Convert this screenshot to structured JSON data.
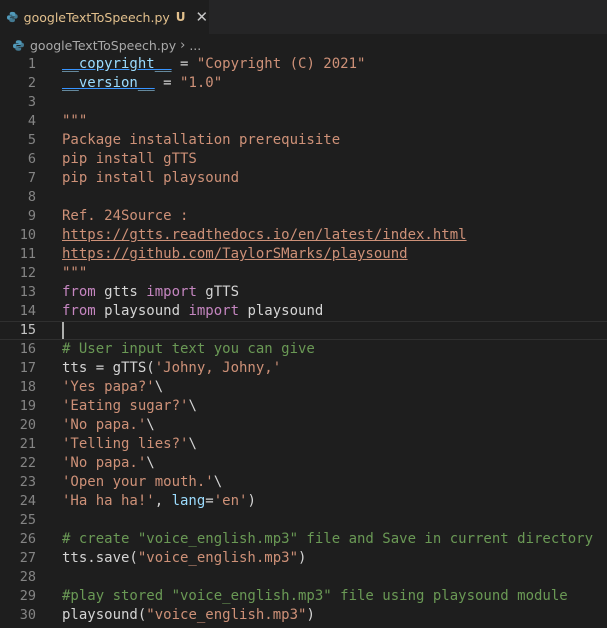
{
  "tab": {
    "filename": "googleTextToSpeech.py",
    "status": "U",
    "close_glyph": "✕",
    "icon": "python-file-icon"
  },
  "breadcrumb": {
    "file": "googleTextToSpeech.py",
    "separator": "›",
    "rest": "..."
  },
  "editor": {
    "current_line": 15,
    "lines": [
      {
        "n": "1",
        "tokens": [
          {
            "t": "__copyright__",
            "c": "t-dunder"
          },
          {
            "t": " = ",
            "c": "t-plain"
          },
          {
            "t": "\"Copyright (C) 2021\"",
            "c": "t-str"
          }
        ]
      },
      {
        "n": "2",
        "tokens": [
          {
            "t": "__version__",
            "c": "t-dunder"
          },
          {
            "t": " = ",
            "c": "t-plain"
          },
          {
            "t": "\"1.0\"",
            "c": "t-str"
          }
        ]
      },
      {
        "n": "3",
        "tokens": []
      },
      {
        "n": "4",
        "tokens": [
          {
            "t": "\"\"\"",
            "c": "t-str"
          }
        ]
      },
      {
        "n": "5",
        "tokens": [
          {
            "t": "Package installation prerequisite",
            "c": "t-str"
          }
        ]
      },
      {
        "n": "6",
        "tokens": [
          {
            "t": "pip install gTTS",
            "c": "t-str"
          }
        ]
      },
      {
        "n": "7",
        "tokens": [
          {
            "t": "pip install playsound",
            "c": "t-str"
          }
        ]
      },
      {
        "n": "8",
        "tokens": []
      },
      {
        "n": "9",
        "tokens": [
          {
            "t": "Ref. 24Source :",
            "c": "t-str"
          }
        ]
      },
      {
        "n": "10",
        "tokens": [
          {
            "t": "https://gtts.readthedocs.io/en/latest/index.html",
            "c": "t-link"
          }
        ]
      },
      {
        "n": "11",
        "tokens": [
          {
            "t": "https://github.com/TaylorSMarks/playsound",
            "c": "t-link"
          }
        ]
      },
      {
        "n": "12",
        "tokens": [
          {
            "t": "\"\"\"",
            "c": "t-str"
          }
        ]
      },
      {
        "n": "13",
        "tokens": [
          {
            "t": "from",
            "c": "t-kw"
          },
          {
            "t": " gtts ",
            "c": "t-plain"
          },
          {
            "t": "import",
            "c": "t-kw"
          },
          {
            "t": " gTTS",
            "c": "t-plain"
          }
        ]
      },
      {
        "n": "14",
        "tokens": [
          {
            "t": "from",
            "c": "t-kw"
          },
          {
            "t": " playsound ",
            "c": "t-plain"
          },
          {
            "t": "import",
            "c": "t-kw"
          },
          {
            "t": " playsound",
            "c": "t-plain"
          }
        ]
      },
      {
        "n": "15",
        "tokens": [],
        "cursor": true
      },
      {
        "n": "16",
        "tokens": [
          {
            "t": "# User input text you can give",
            "c": "t-cm"
          }
        ]
      },
      {
        "n": "17",
        "tokens": [
          {
            "t": "tts = gTTS(",
            "c": "t-plain"
          },
          {
            "t": "'Johny, Johny,'",
            "c": "t-str"
          }
        ]
      },
      {
        "n": "18",
        "tokens": [
          {
            "t": "'Yes papa?'",
            "c": "t-str"
          },
          {
            "t": "\\",
            "c": "t-plain"
          }
        ]
      },
      {
        "n": "19",
        "tokens": [
          {
            "t": "'Eating sugar?'",
            "c": "t-str"
          },
          {
            "t": "\\",
            "c": "t-plain"
          }
        ]
      },
      {
        "n": "20",
        "tokens": [
          {
            "t": "'No papa.'",
            "c": "t-str"
          },
          {
            "t": "\\",
            "c": "t-plain"
          }
        ]
      },
      {
        "n": "21",
        "tokens": [
          {
            "t": "'Telling lies?'",
            "c": "t-str"
          },
          {
            "t": "\\",
            "c": "t-plain"
          }
        ]
      },
      {
        "n": "22",
        "tokens": [
          {
            "t": "'No papa.'",
            "c": "t-str"
          },
          {
            "t": "\\",
            "c": "t-plain"
          }
        ]
      },
      {
        "n": "23",
        "tokens": [
          {
            "t": "'Open your mouth.'",
            "c": "t-str"
          },
          {
            "t": "\\",
            "c": "t-plain"
          }
        ]
      },
      {
        "n": "24",
        "tokens": [
          {
            "t": "'Ha ha ha!'",
            "c": "t-str"
          },
          {
            "t": ", ",
            "c": "t-plain"
          },
          {
            "t": "lang",
            "c": "t-var"
          },
          {
            "t": "=",
            "c": "t-plain"
          },
          {
            "t": "'en'",
            "c": "t-str"
          },
          {
            "t": ")",
            "c": "t-plain"
          }
        ]
      },
      {
        "n": "25",
        "tokens": []
      },
      {
        "n": "26",
        "tokens": [
          {
            "t": "# create \"voice_english.mp3\" file and Save in current directory",
            "c": "t-cm"
          }
        ]
      },
      {
        "n": "27",
        "tokens": [
          {
            "t": "tts.save(",
            "c": "t-plain"
          },
          {
            "t": "\"voice_english.mp3\"",
            "c": "t-str"
          },
          {
            "t": ")",
            "c": "t-plain"
          }
        ]
      },
      {
        "n": "28",
        "tokens": []
      },
      {
        "n": "29",
        "tokens": [
          {
            "t": "#play stored \"voice_english.mp3\" file using playsound module",
            "c": "t-cm"
          }
        ]
      },
      {
        "n": "30",
        "tokens": [
          {
            "t": "playsound(",
            "c": "t-plain"
          },
          {
            "t": "\"voice_english.mp3\"",
            "c": "t-str"
          },
          {
            "t": ")",
            "c": "t-plain"
          }
        ]
      }
    ]
  }
}
